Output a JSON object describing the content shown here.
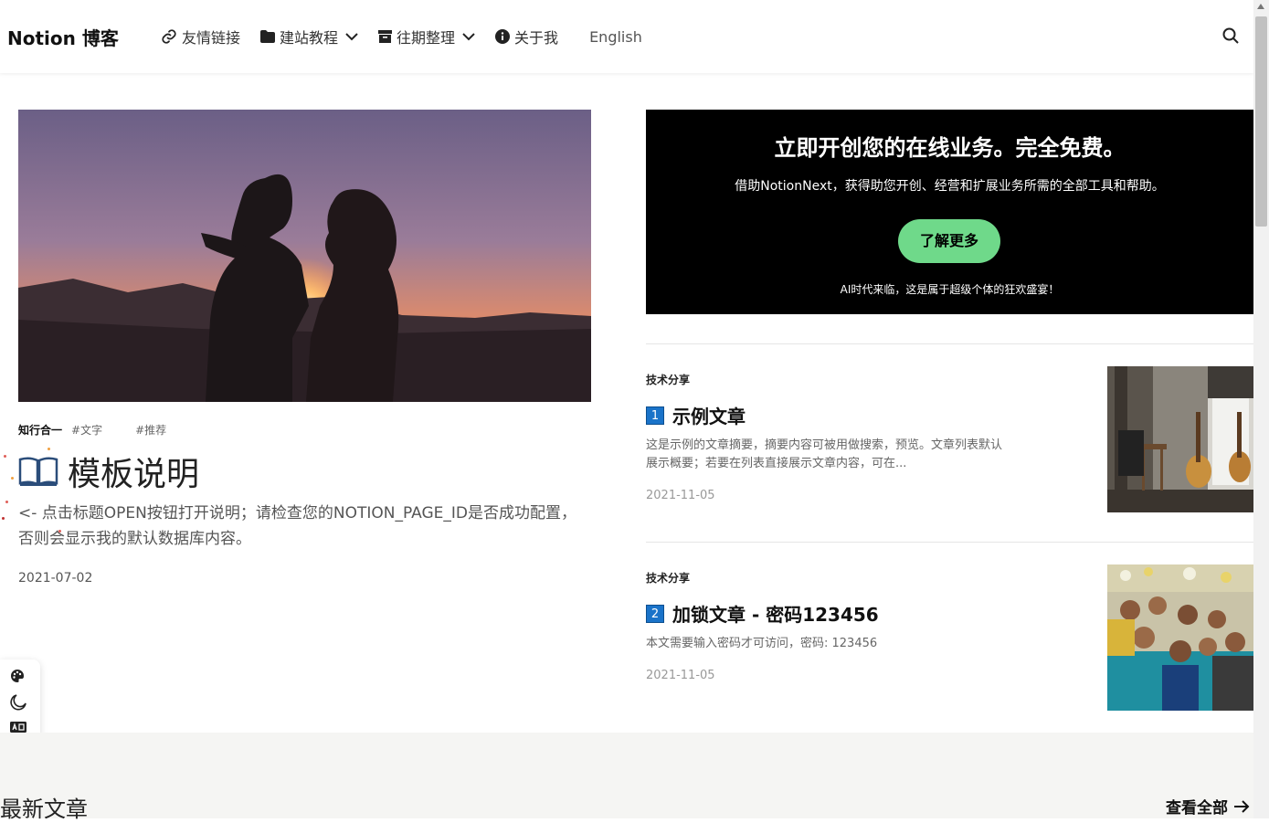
{
  "header": {
    "logo": "Notion 博客",
    "nav": [
      {
        "label": "友情链接",
        "icon": "link-icon"
      },
      {
        "label": "建站教程",
        "icon": "folder-icon",
        "dropdown": true
      },
      {
        "label": "往期整理",
        "icon": "archive-icon",
        "dropdown": true
      },
      {
        "label": "关于我",
        "icon": "info-icon"
      },
      {
        "label": "English"
      }
    ],
    "search_icon": "search-icon"
  },
  "hero": {
    "category": "知行合一",
    "tags": [
      "#文字",
      "#推荐"
    ],
    "title": "模板说明",
    "title_icon": "open-book-icon",
    "summary": "<- 点击标题OPEN按钮打开说明；请检查您的NOTION_PAGE_ID是否成功配置，否则会显示我的默认数据库内容。",
    "date": "2021-07-02"
  },
  "promo": {
    "title": "立即开创您的在线业务。完全免费。",
    "subtitle": "借助NotionNext，获得助您开创、经营和扩展业务所需的全部工具和帮助。",
    "button": "了解更多",
    "footer": "AI时代来临，这是属于超级个体的狂欢盛宴！",
    "button_color": "#6fd98a"
  },
  "articles": [
    {
      "category": "技术分享",
      "number": "1",
      "title": "示例文章",
      "summary": "这是示例的文章摘要，摘要内容可被用做搜索，预览。文章列表默认展示概要；若要在列表直接展示文章内容，可在...",
      "date": "2021-11-05"
    },
    {
      "category": "技术分享",
      "number": "2",
      "title": "加锁文章 - 密码123456",
      "summary": "本文需要输入密码才可访问，密码: 123456",
      "date": "2021-11-05"
    }
  ],
  "tools": [
    "palette-icon",
    "moon-icon",
    "translate-icon"
  ],
  "latest": {
    "title": "最新文章",
    "view_all": "查看全部"
  }
}
